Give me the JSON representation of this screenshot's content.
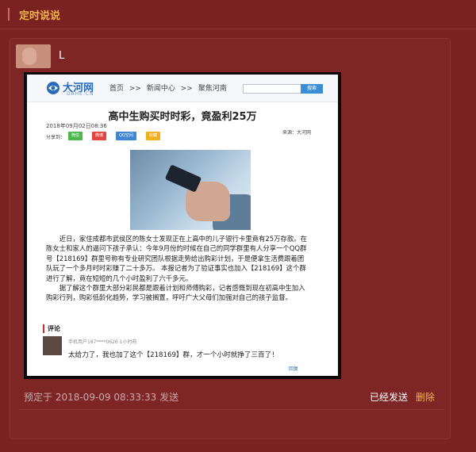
{
  "header": {
    "title": "定时说说"
  },
  "post": {
    "username": "L",
    "scheduled_time": "预定于 2018-09-09 08:33:33 发送",
    "status": "已经发送",
    "delete_label": "删除"
  },
  "article": {
    "site_name": "大河网",
    "site_sub": "DAHE.CN",
    "breadcrumb": [
      "首页",
      ">>",
      "新闻中心",
      ">>",
      "聚焦河南"
    ],
    "search_button": "搜索",
    "headline": "高中生购买时时彩，竟盈利25万",
    "date": "2018年09月02日08:36",
    "source": "来源：大河网",
    "share_label": "分享到：",
    "share_buttons": [
      "微信",
      "微博",
      "QQ空间",
      "收藏"
    ],
    "paragraphs": [
      "近日，家住成都市武侯区的陈女士发现正在上高中的儿子银行卡里竟有25万存款。在陈女士和家人的逼问下孩子承认：今年9月份的时候在自己的同学群里有人分享一个QQ群号【218169】群里号称有专业研究团队根据走势给出购彩计划，于是便拿生活费跟着团队玩了一个多月时时彩赚了二十多万。 本报记者为了验证事实也加入【218169】这个群进行了解，竟在短短的几个小时盈利了六千多元。",
      "据了解这个群里大部分彩民都是跟着计划和师傅购彩，记者感慨到现在初高中生加入购彩行列，购彩低龄化趋势，学习被搁置，呼吁广大父母们加强对自己的孩子监督。"
    ],
    "comment_title": "评论",
    "comment_meta": "手机用户187****0626 1小时前",
    "comment_text": "太给力了，我也加了这个【218169】群，才一个小时就挣了三百了！",
    "comment_like": "回复"
  },
  "colors": {
    "background": "#7a2222",
    "accent": "#f0b44a",
    "link_blue": "#2a6bb8"
  }
}
